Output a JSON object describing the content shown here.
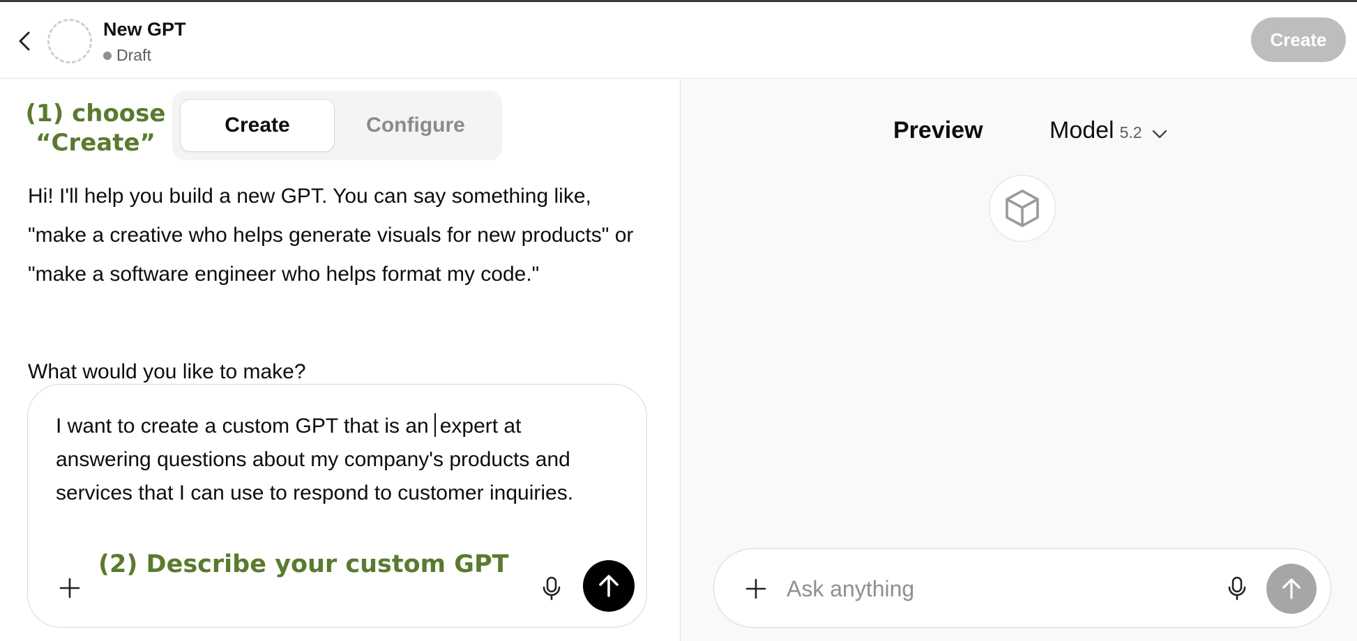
{
  "header": {
    "title": "New GPT",
    "status": "Draft",
    "create_button": "Create",
    "back_icon": "chevron-left-icon"
  },
  "annotations": {
    "step1_line1": "(1) choose",
    "step1_line2": "“Create”",
    "step2": "(2) Describe your custom GPT"
  },
  "tabs": [
    {
      "label": "Create",
      "selected": true
    },
    {
      "label": "Configure",
      "selected": false
    }
  ],
  "chat": {
    "intro": "Hi! I'll help you build a new GPT. You can say something like, \"make a creative who helps generate visuals for new products\" or \"make a software engineer who helps format my code.\"",
    "question": "What would you like to make?"
  },
  "composer": {
    "text_before_caret": "I want to create a custom GPT that is an",
    "text_after_caret": "expert at answering questions about my company's products and services that I can use to respond to customer inquiries."
  },
  "preview": {
    "title": "Preview",
    "model_label": "Model",
    "model_version": "5.2",
    "placeholder": "Ask anything",
    "gpt_icon": "cube-icon"
  },
  "colors": {
    "annotation_green": "#5a7a2e",
    "send_active": "#000000",
    "send_disabled": "#a6a6a6",
    "create_disabled": "#bdbdbd"
  }
}
